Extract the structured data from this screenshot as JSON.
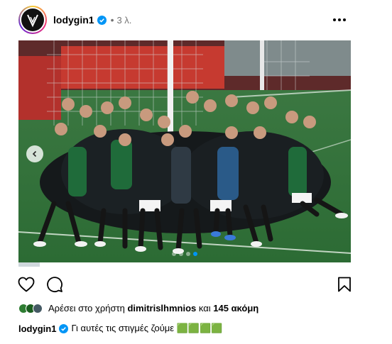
{
  "post": {
    "username": "lodygin1",
    "separator": "•",
    "time_ago": "3 λ.",
    "verified": true
  },
  "carousel": {
    "slide_count": 4,
    "active_index": 3
  },
  "likes": {
    "prefix": "Αρέσει στο χρήστη",
    "user": "dimitrislhmnios",
    "middle": "και",
    "count": "145 ακόμη"
  },
  "caption": {
    "username": "lodygin1",
    "text": "Γι αυτές τις στιγμές ζούμε 🟩🟩🟩🟩"
  },
  "icons": {
    "more": "more-horizontal-icon",
    "like": "heart-icon",
    "comment": "comment-icon",
    "save": "bookmark-icon",
    "prev": "chevron-left-icon"
  },
  "colors": {
    "verified": "#0095f6",
    "meta": "#737373",
    "pitch": "#2f6a38",
    "kit_green": "#1f6b3a"
  }
}
